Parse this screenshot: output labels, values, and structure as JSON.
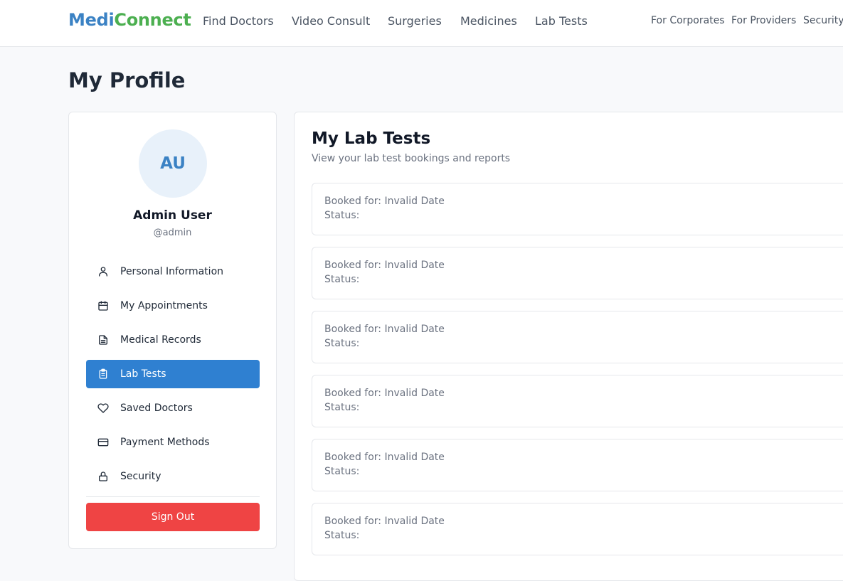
{
  "header": {
    "logo_part1": "Medi",
    "logo_part2": "Connect",
    "nav": [
      "Find Doctors",
      "Video Consult",
      "Surgeries",
      "Medicines",
      "Lab Tests"
    ],
    "secondary_nav": [
      "For Corporates",
      "For Providers",
      "Security"
    ]
  },
  "page": {
    "title": "My Profile"
  },
  "profile": {
    "initials": "AU",
    "name": "Admin User",
    "handle": "@admin"
  },
  "sidebar": {
    "items": [
      {
        "label": "Personal Information",
        "icon": "user-icon"
      },
      {
        "label": "My Appointments",
        "icon": "calendar-icon"
      },
      {
        "label": "Medical Records",
        "icon": "document-icon"
      },
      {
        "label": "Lab Tests",
        "icon": "clipboard-icon",
        "active": true
      },
      {
        "label": "Saved Doctors",
        "icon": "heart-icon"
      },
      {
        "label": "Payment Methods",
        "icon": "credit-card-icon"
      },
      {
        "label": "Security",
        "icon": "lock-icon"
      }
    ],
    "sign_out": "Sign Out"
  },
  "main": {
    "title": "My Lab Tests",
    "subtitle": "View your lab test bookings and reports",
    "bookings": [
      {
        "booked_for": "Booked for: Invalid Date",
        "status": "Status:"
      },
      {
        "booked_for": "Booked for: Invalid Date",
        "status": "Status:"
      },
      {
        "booked_for": "Booked for: Invalid Date",
        "status": "Status:"
      },
      {
        "booked_for": "Booked for: Invalid Date",
        "status": "Status:"
      },
      {
        "booked_for": "Booked for: Invalid Date",
        "status": "Status:"
      },
      {
        "booked_for": "Booked for: Invalid Date",
        "status": "Status:"
      }
    ]
  },
  "colors": {
    "primary": "#2f80d1",
    "logo_blue": "#3b82c4",
    "logo_green": "#4caf50",
    "danger": "#ef4444"
  }
}
